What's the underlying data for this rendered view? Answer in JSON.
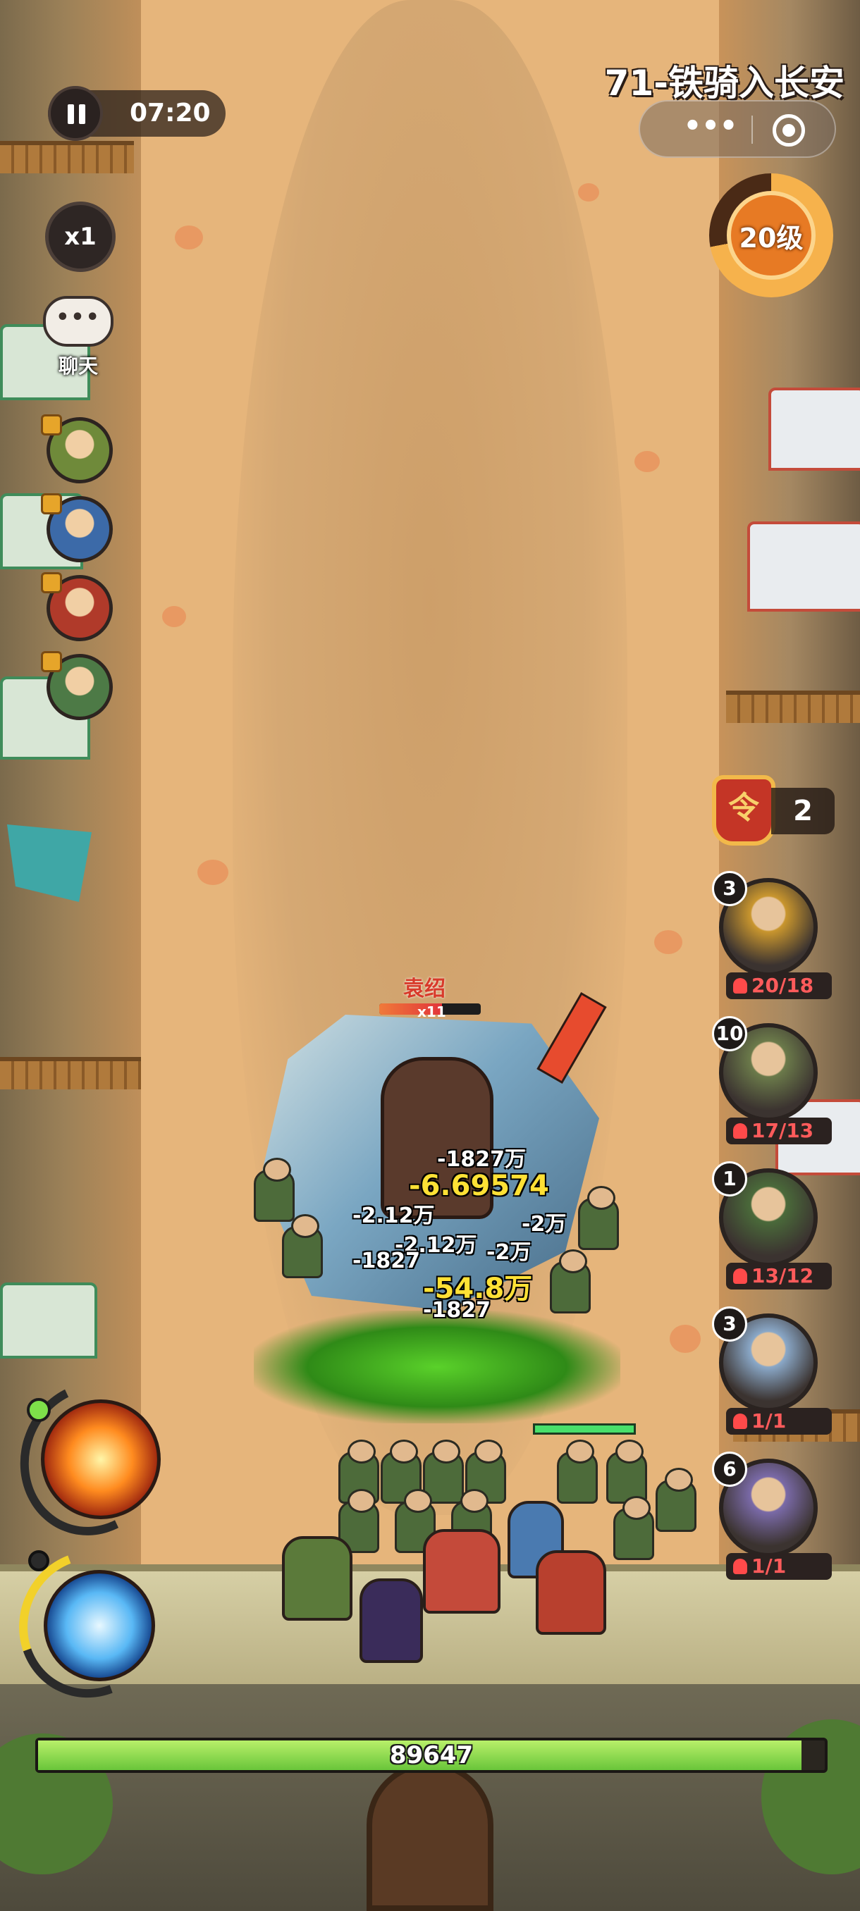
{
  "hud": {
    "timer": "07:20",
    "speed": "x1",
    "chat_label": "聊天",
    "chat_icon_text": "•••",
    "stage_title": "71-铁骑入长安",
    "capsule_more": "•••",
    "level_label": "20级",
    "level_progress": 0.72
  },
  "heroes": [
    {
      "name": "hero-1",
      "color": "#6f8a3a"
    },
    {
      "name": "hero-2",
      "color": "#3c6aa8"
    },
    {
      "name": "hero-3",
      "color": "#b03a2a"
    },
    {
      "name": "hero-4",
      "color": "#4d7a46"
    }
  ],
  "token": {
    "count": "2",
    "icon_text": "令"
  },
  "units": [
    {
      "badge": "3",
      "count": "20/18",
      "color": "#c9962e"
    },
    {
      "badge": "10",
      "count": "17/13",
      "color": "#6b7a4a"
    },
    {
      "badge": "1",
      "count": "13/12",
      "color": "#4a6a3a"
    },
    {
      "badge": "3",
      "count": "1/1",
      "color": "#8aa8c8"
    },
    {
      "badge": "6",
      "count": "1/1",
      "color": "#7a6aa8"
    }
  ],
  "boss": {
    "name": "袁绍",
    "multiplier": "x11",
    "hp_fraction": 0.62
  },
  "damage_numbers": [
    {
      "text": "-1827万",
      "big": false
    },
    {
      "text": "-6.69574",
      "big": true
    },
    {
      "text": "-2.12万",
      "big": false
    },
    {
      "text": "-2万",
      "big": false
    },
    {
      "text": "-2.12万",
      "big": false
    },
    {
      "text": "-2万",
      "big": false
    },
    {
      "text": "-1827",
      "big": false
    },
    {
      "text": "-54.8万",
      "big": true
    },
    {
      "text": "-1827",
      "big": false
    }
  ],
  "base": {
    "hp": "89647",
    "hp_fraction": 0.97
  }
}
